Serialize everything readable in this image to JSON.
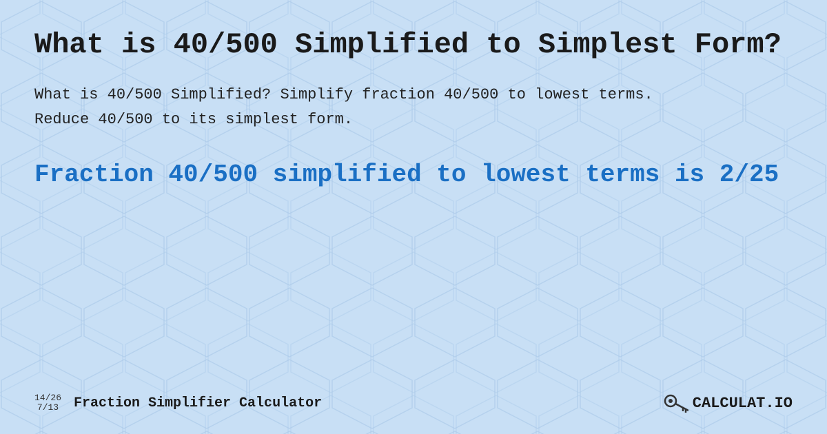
{
  "page": {
    "title": "What is 40/500 Simplified to Simplest Form?",
    "description": "What is 40/500 Simplified? Simplify fraction 40/500 to lowest terms. Reduce 40/500 to its simplest form.",
    "result": "Fraction 40/500 simplified to lowest terms is 2/25",
    "background_color": "#c8dff5"
  },
  "footer": {
    "fraction_top": "14/26",
    "fraction_bottom": "7/13",
    "site_title": "Fraction Simplifier Calculator",
    "logo_text": "CALCULAT.IO"
  }
}
